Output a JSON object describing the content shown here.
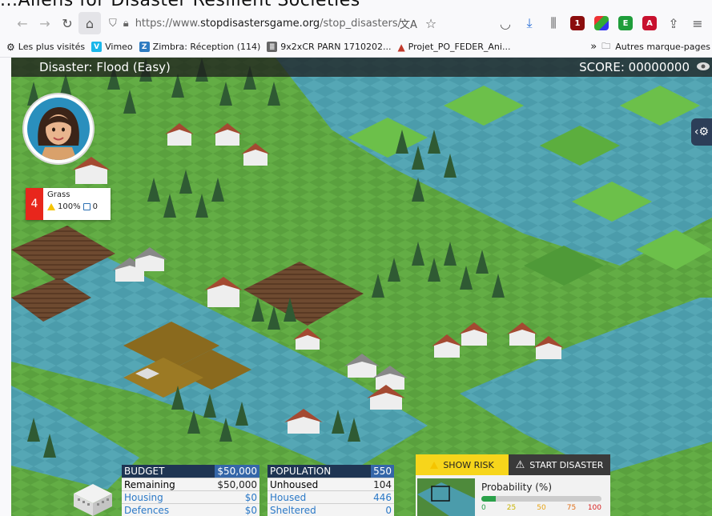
{
  "page_title_partial": "...Aliens for Disaster Resilient Societies",
  "browser": {
    "url_prefix": "https://www.",
    "url_host": "stopdisastersgame.org",
    "url_path": "/stop_disasters/",
    "extension_badge": "1",
    "bookmarks": [
      {
        "label": "Les plus visités",
        "icon": "gear-icon"
      },
      {
        "label": "Vimeo",
        "icon": "vimeo-icon",
        "color": "#1ab7ea"
      },
      {
        "label": "Zimbra: Réception (114)",
        "icon": "zimbra-icon",
        "color": "#2f7cc1"
      },
      {
        "label": "9x2xCR PARN 1710202...",
        "icon": "document-icon"
      },
      {
        "label": "Projet_PO_FEDER_Ani...",
        "icon": "a-logo-icon"
      }
    ],
    "bookmarks_overflow": "»",
    "other_bookmarks": "Autres marque-pages"
  },
  "game": {
    "disaster_title": "Disaster: Flood (Easy)",
    "score": "SCORE: 00000000",
    "tile_info": {
      "number": "4",
      "terrain": "Grass",
      "risk": "100%",
      "housing": "0"
    },
    "budget": {
      "header": "BUDGET",
      "header_value": "$50,000",
      "rows": [
        {
          "label": "Remaining",
          "value": "$50,000",
          "highlight": false
        },
        {
          "label": "Housing",
          "value": "$0",
          "highlight": true
        },
        {
          "label": "Defences",
          "value": "$0",
          "highlight": true
        }
      ]
    },
    "population": {
      "header": "POPULATION",
      "header_value": "550",
      "rows": [
        {
          "label": "Unhoused",
          "value": "104",
          "highlight": false
        },
        {
          "label": "Housed",
          "value": "446",
          "highlight": true
        },
        {
          "label": "Sheltered",
          "value": "0",
          "highlight": true
        }
      ]
    },
    "controls": {
      "show_risk": "SHOW RISK",
      "start_disaster": "START DISASTER",
      "probability_title": "Probability (%)",
      "probability_value_pct": 12,
      "ticks": [
        {
          "label": "0",
          "color": "#2aa14a"
        },
        {
          "label": "25",
          "color": "#c9b400"
        },
        {
          "label": "50",
          "color": "#e7a417"
        },
        {
          "label": "75",
          "color": "#e0701a"
        },
        {
          "label": "100",
          "color": "#d81f1f"
        }
      ]
    }
  }
}
